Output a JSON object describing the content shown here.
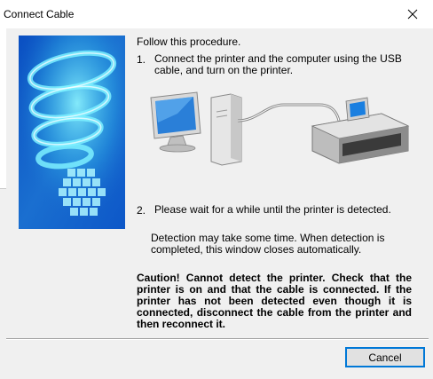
{
  "window": {
    "title": "Connect Cable",
    "close_icon": "close-icon"
  },
  "content": {
    "intro": "Follow this procedure.",
    "steps": [
      {
        "number": "1.",
        "text": "Connect the printer and the computer using the USB cable, and turn on the printer."
      },
      {
        "number": "2.",
        "text": "Please wait for a while until the printer is detected."
      }
    ],
    "detection_note": "Detection may take some time. When detection is completed, this window closes automatically.",
    "caution": "Caution! Cannot detect the printer. Check that the printer is on and that the cable is connected. If the printer has not been detected even though it is connected, disconnect the cable from the printer and then reconnect it."
  },
  "buttons": {
    "cancel": "Cancel"
  },
  "colors": {
    "banner_blue": "#1a6fd0",
    "banner_cyan": "#5fe7ff",
    "button_focus": "#0078d7"
  },
  "icons": {
    "banner": "spiral-banner-image",
    "illustration": "computer-printer-connection-illustration"
  }
}
